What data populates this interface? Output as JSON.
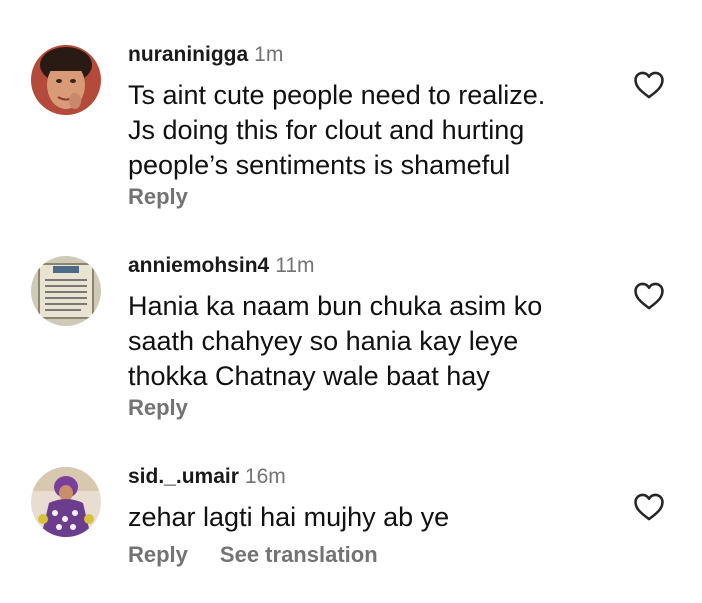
{
  "comments": [
    {
      "username": "nuraninigga",
      "time": "1m",
      "lines": [
        "Ts aint cute people need to realize.",
        "Js doing this for clout and hurting",
        "people’s sentiments is shameful"
      ],
      "reply_label": "Reply",
      "like_icon": "heart-outline-icon"
    },
    {
      "username": "anniemohsin4",
      "time": "11m",
      "lines": [
        "Hania ka naam bun chuka asim ko",
        "saath chahyey so hania kay leye",
        "thokka Chatnay wale baat hay"
      ],
      "reply_label": "Reply",
      "like_icon": "heart-outline-icon"
    },
    {
      "username": "sid._.umair",
      "time": "16m",
      "lines": [
        "zehar lagti hai mujhy ab ye"
      ],
      "reply_label": "Reply",
      "translate_label": "See translation",
      "like_icon": "heart-outline-icon"
    }
  ],
  "colors": {
    "text": "#111111",
    "muted": "#737373",
    "background": "#ffffff"
  }
}
